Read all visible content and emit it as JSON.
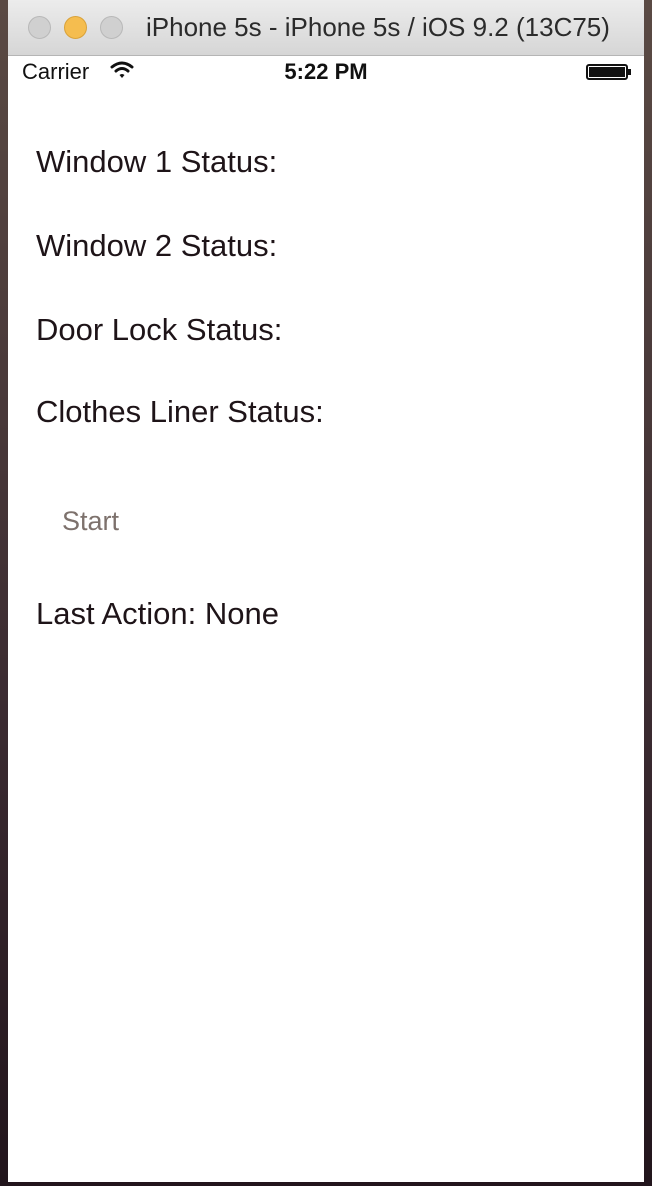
{
  "window": {
    "title": "iPhone 5s - iPhone 5s / iOS 9.2 (13C75)"
  },
  "status_bar": {
    "carrier": "Carrier",
    "time": "5:22 PM",
    "wifi_icon": "wifi-icon",
    "battery_icon": "battery-icon"
  },
  "labels": {
    "window1": "Window 1 Status:",
    "window2": "Window 2 Status:",
    "door_lock": "Door Lock Status:",
    "clothes_liner": "Clothes Liner Status:",
    "last_action": "Last Action: None"
  },
  "buttons": {
    "start": "Start"
  },
  "colors": {
    "start_button": "#7d716c",
    "min_light": "#f5bd4f"
  }
}
